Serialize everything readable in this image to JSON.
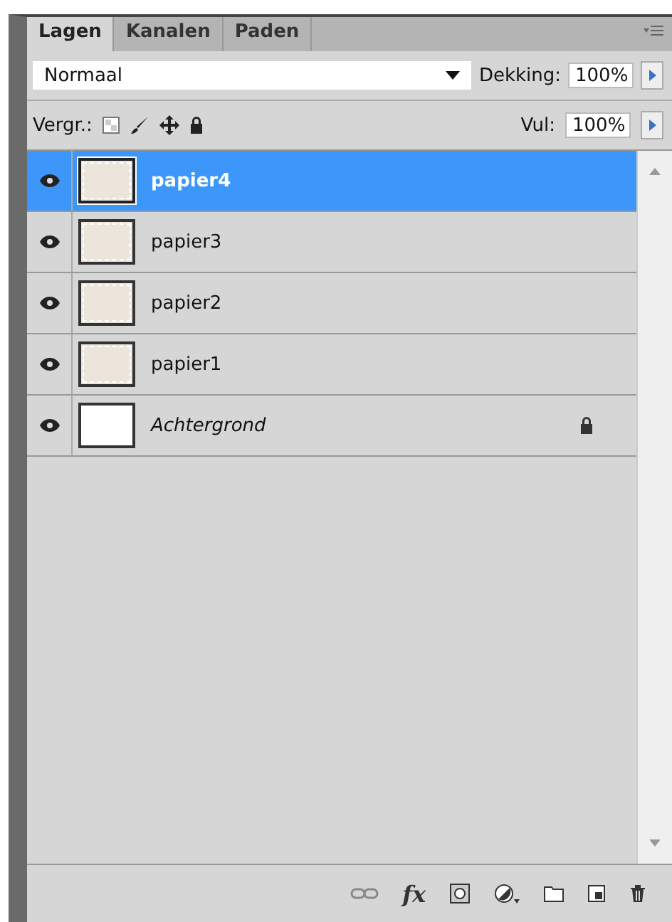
{
  "tabs": [
    {
      "label": "Lagen",
      "selected": true
    },
    {
      "label": "Kanalen",
      "selected": false
    },
    {
      "label": "Paden",
      "selected": false
    }
  ],
  "blend_mode": {
    "value": "Normaal"
  },
  "opacity": {
    "label": "Dekking:",
    "value": "100%"
  },
  "lock": {
    "label": "Vergr.:"
  },
  "fill": {
    "label": "Vul:",
    "value": "100%"
  },
  "layers": [
    {
      "name": "papier4",
      "kind": "paper",
      "visible": true,
      "selected": true,
      "locked": false
    },
    {
      "name": "papier3",
      "kind": "paper",
      "visible": true,
      "selected": false,
      "locked": false
    },
    {
      "name": "papier2",
      "kind": "paper",
      "visible": true,
      "selected": false,
      "locked": false
    },
    {
      "name": "papier1",
      "kind": "paper",
      "visible": true,
      "selected": false,
      "locked": false
    },
    {
      "name": "Achtergrond",
      "kind": "background",
      "visible": true,
      "selected": false,
      "locked": true
    }
  ],
  "toolbar": {
    "fx_label": "fx"
  }
}
